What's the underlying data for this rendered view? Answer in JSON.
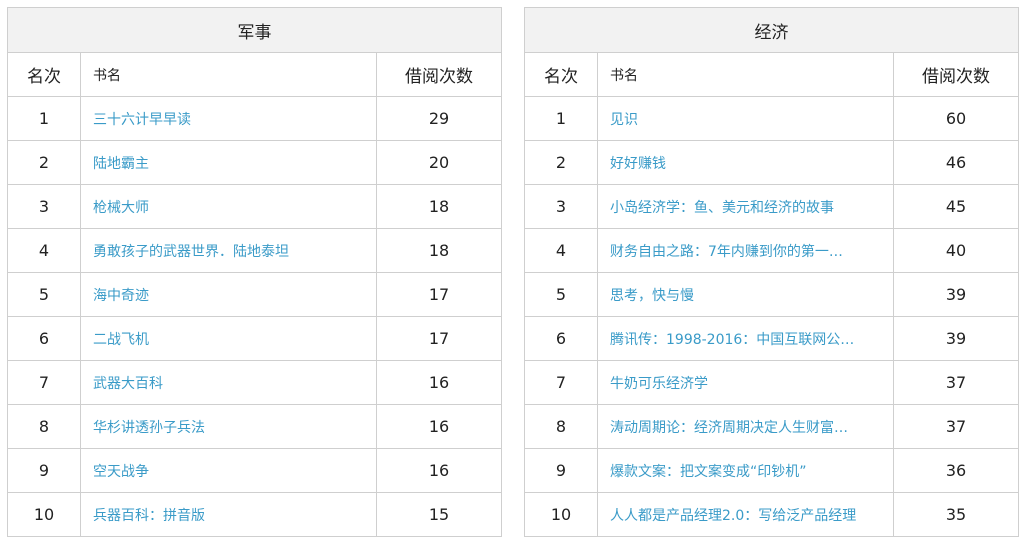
{
  "tables": [
    {
      "category": "军事",
      "headers": {
        "rank": "名次",
        "title": "书名",
        "count": "借阅次数"
      },
      "rows": [
        {
          "rank": "1",
          "title": "三十六计早早读",
          "count": "29"
        },
        {
          "rank": "2",
          "title": "陆地霸主",
          "count": "20"
        },
        {
          "rank": "3",
          "title": "枪械大师",
          "count": "18"
        },
        {
          "rank": "4",
          "title": "勇敢孩子的武器世界．陆地泰坦",
          "count": "18"
        },
        {
          "rank": "5",
          "title": "海中奇迹",
          "count": "17"
        },
        {
          "rank": "6",
          "title": "二战飞机",
          "count": "17"
        },
        {
          "rank": "7",
          "title": "武器大百科",
          "count": "16"
        },
        {
          "rank": "8",
          "title": "华杉讲透孙子兵法",
          "count": "16"
        },
        {
          "rank": "9",
          "title": "空天战争",
          "count": "16"
        },
        {
          "rank": "10",
          "title": "兵器百科：拼音版",
          "count": "15"
        }
      ]
    },
    {
      "category": "经济",
      "headers": {
        "rank": "名次",
        "title": "书名",
        "count": "借阅次数"
      },
      "rows": [
        {
          "rank": "1",
          "title": "见识",
          "count": "60"
        },
        {
          "rank": "2",
          "title": "好好赚钱",
          "count": "46"
        },
        {
          "rank": "3",
          "title": "小岛经济学：鱼、美元和经济的故事",
          "count": "45"
        },
        {
          "rank": "4",
          "title": "财务自由之路：7年内赚到你的第一…",
          "count": "40"
        },
        {
          "rank": "5",
          "title": "思考，快与慢",
          "count": "39"
        },
        {
          "rank": "6",
          "title": "腾讯传：1998-2016：中国互联网公…",
          "count": "39"
        },
        {
          "rank": "7",
          "title": "牛奶可乐经济学",
          "count": "37"
        },
        {
          "rank": "8",
          "title": "涛动周期论：经济周期决定人生财富…",
          "count": "37"
        },
        {
          "rank": "9",
          "title": "爆款文案：把文案变成“印钞机”",
          "count": "36"
        },
        {
          "rank": "10",
          "title": "人人都是产品经理2.0：写给泛产品经理",
          "count": "35"
        }
      ]
    }
  ],
  "colors": {
    "link": "#3a9bc8",
    "border": "#cfcfcf",
    "caption_bg": "#f2f2f2"
  }
}
